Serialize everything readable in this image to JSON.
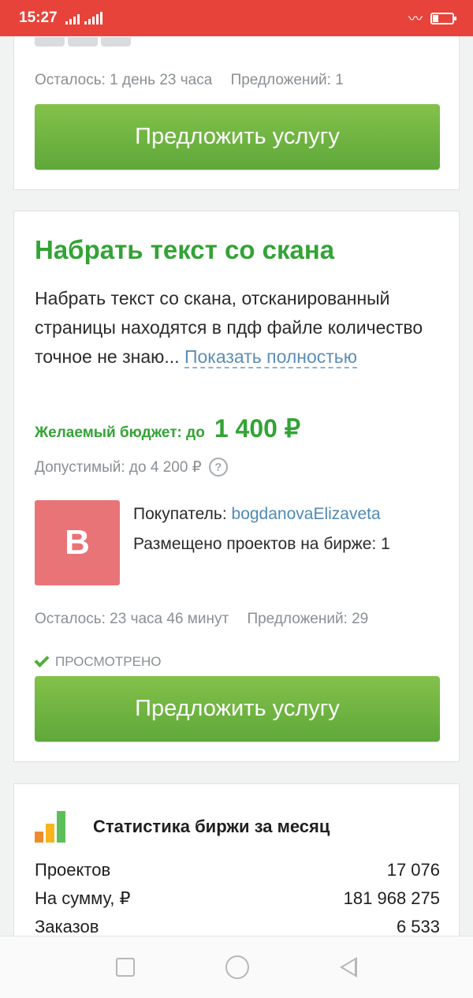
{
  "status_bar": {
    "time": "15:27",
    "left_icons": [
      "signal-icon",
      "signal-icon"
    ],
    "right_icons": [
      "vibrate-icon",
      "battery-icon"
    ]
  },
  "card_prev": {
    "remaining": "Осталось: 1 день 23 часа",
    "offers": "Предложений: 1",
    "offer_button": "Предложить услугу"
  },
  "project": {
    "title": "Набрать текст со скана",
    "description": "Набрать текст со скана, отсканированный страницы находятся в пдф файле количество точное не знаю... ",
    "show_more": "Показать полностью",
    "budget_label": "Желаемый бюджет: до",
    "budget_value": "1 400 ₽",
    "allowed": "Допустимый: до 4 200 ₽",
    "help_symbol": "?",
    "avatar_letter": "B",
    "avatar_color": "#e87478",
    "buyer_label": "Покупатель: ",
    "buyer_name": "bogdanovaElizaveta",
    "projects_posted": "Размещено проектов на бирже: 1",
    "remaining": "Осталось: 23 часа 46 минут",
    "offers": "Предложений: 29",
    "viewed": "ПРОСМОТРЕНО",
    "offer_button": "Предложить услугу"
  },
  "stats": {
    "title": "Статистика биржи за месяц",
    "rows": [
      {
        "label": "Проектов",
        "value": "17 076"
      },
      {
        "label": "На сумму, ₽",
        "value": "181 968 275"
      },
      {
        "label": "Заказов",
        "value": "6 533"
      }
    ]
  },
  "colors": {
    "status_bar": "#e8433a",
    "accent_green": "#33a335",
    "button_green": "#6db241",
    "link_blue": "#4f8ab4"
  }
}
